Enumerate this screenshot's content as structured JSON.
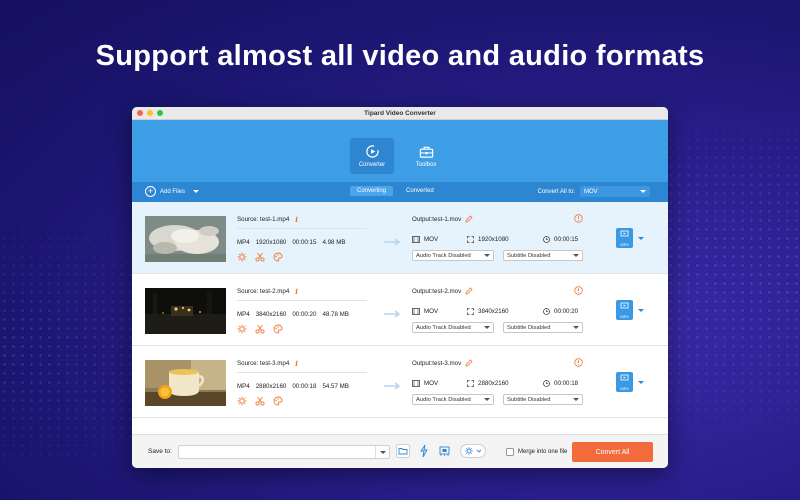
{
  "headline": "Support almost all video and audio formats",
  "window": {
    "title": "Tipard Video Converter"
  },
  "nav": {
    "converter_label": "Converter",
    "toolbox_label": "Toolbox"
  },
  "toolbar": {
    "add_files_label": "Add Files",
    "tabs": [
      "Converting",
      "Converted"
    ],
    "convert_all_to_label": "Convert All to:",
    "convert_all_to_value": "MOV"
  },
  "files": [
    {
      "source": "Source: test-1.mp4",
      "format": "MP4",
      "resolution": "1920x1080",
      "duration": "00:00:15",
      "size": "4.98 MB",
      "output": "Output:test-1.mov",
      "out_format": "MOV",
      "out_resolution": "1920x1080",
      "out_duration": "00:00:15",
      "audio_track": "Audio Track Disabled",
      "subtitle": "Subtitle Disabled",
      "format_badge": "MP4"
    },
    {
      "source": "Source: test-2.mp4",
      "format": "MP4",
      "resolution": "3840x2160",
      "duration": "00:00:20",
      "size": "48.78 MB",
      "output": "Output:test-2.mov",
      "out_format": "MOV",
      "out_resolution": "3840x2160",
      "out_duration": "00:00:20",
      "audio_track": "Audio Track Disabled",
      "subtitle": "Subtitle Disabled",
      "format_badge": "MP4"
    },
    {
      "source": "Source: test-3.mp4",
      "format": "MP4",
      "resolution": "2880x2160",
      "duration": "00:00:18",
      "size": "54.57 MB",
      "output": "Output:test-3.mov",
      "out_format": "MOV",
      "out_resolution": "2880x2160",
      "out_duration": "00:00:18",
      "audio_track": "Audio Track Disabled",
      "subtitle": "Subtitle Disabled",
      "format_badge": "MP4"
    }
  ],
  "footer": {
    "save_to_label": "Save to:",
    "save_path": "",
    "merge_label": "Merge into one file",
    "convert_all_button": "Convert All"
  },
  "colors": {
    "accent_blue": "#3d9ee6",
    "toolbar_blue": "#2c86d2",
    "convert_orange": "#f36b3a",
    "edit_icon_orange": "#f07a3a"
  }
}
